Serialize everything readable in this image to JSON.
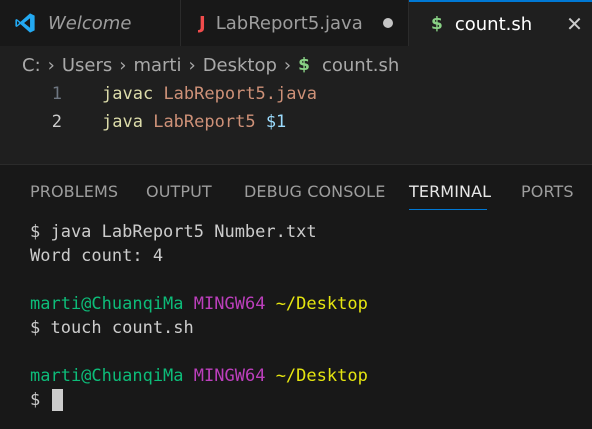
{
  "tabs": [
    {
      "label": "Welcome",
      "icon": "vscode-logo-icon"
    },
    {
      "label": "LabReport5.java",
      "icon": "java-icon",
      "modified": true
    },
    {
      "label": "count.sh",
      "icon": "shell-dollar-icon",
      "active": true
    }
  ],
  "breadcrumb": {
    "items": [
      "C:",
      "Users",
      "marti",
      "Desktop"
    ],
    "file": "count.sh"
  },
  "editor": {
    "lines": [
      {
        "number": "1",
        "cmd": "javac",
        "arg": "LabReport5.java",
        "var": ""
      },
      {
        "number": "2",
        "cmd": "java",
        "arg": "LabReport5",
        "var": "$1"
      }
    ]
  },
  "panel_tabs": [
    "PROBLEMS",
    "OUTPUT",
    "DEBUG CONSOLE",
    "TERMINAL",
    "PORTS"
  ],
  "active_panel_tab": "TERMINAL",
  "terminal": {
    "line1": "$ java LabReport5 Number.txt",
    "line2": "Word count: 4",
    "prompt1": {
      "user": "marti@ChuanqiMa",
      "host": "MINGW64",
      "path": "~/Desktop"
    },
    "line4": "$ touch count.sh",
    "prompt2": {
      "user": "marti@ChuanqiMa",
      "host": "MINGW64",
      "path": "~/Desktop"
    },
    "line6": "$"
  },
  "colors": {
    "accent": "#0078d4",
    "java_icon": "#f14c4c",
    "shell_icon": "#89d185",
    "prompt_user": "#0dbc79",
    "prompt_host": "#bc3fbc",
    "prompt_path": "#e5e510"
  }
}
